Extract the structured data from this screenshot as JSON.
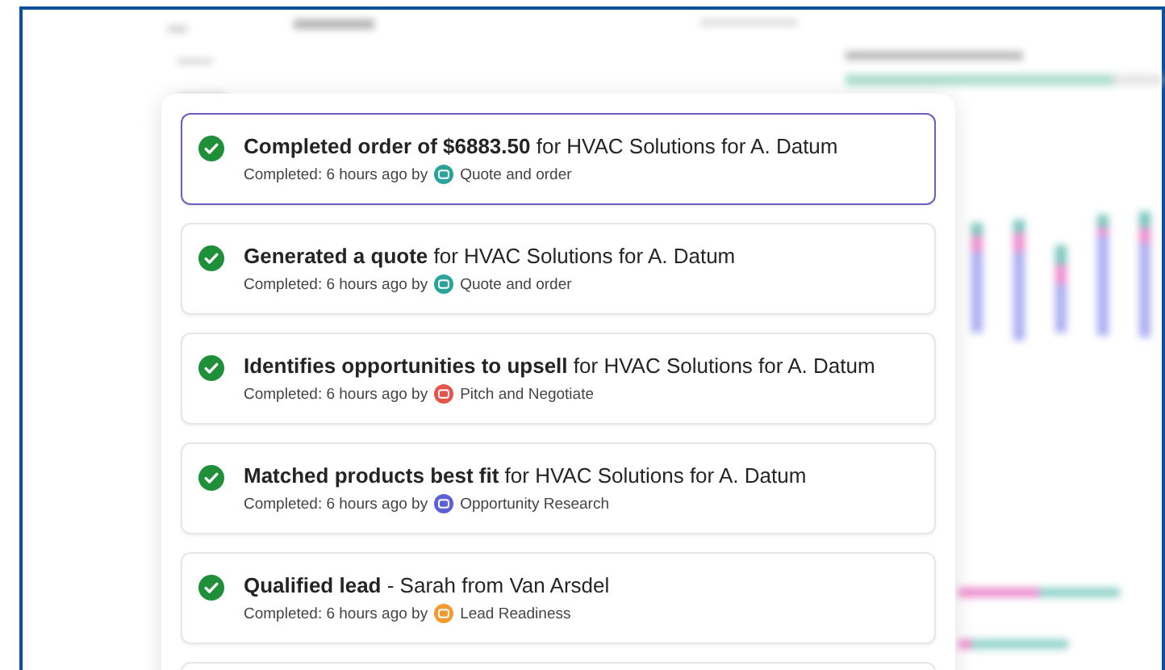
{
  "activity_feed": [
    {
      "title": "**Completed order of $6883.50** for HVAC Solutions for A. Datum",
      "meta": "Completed: 6 hours ago by",
      "agent": "Quote and order",
      "color": "#2aa39c",
      "selected": true
    },
    {
      "title": "**Generated a quote** for HVAC Solutions for A. Datum",
      "meta": "Completed: 6 hours ago by",
      "agent": "Quote and order",
      "color": "#2aa39c",
      "selected": false
    },
    {
      "title": "**Identifies opportunities to upsell** for HVAC Solutions for A. Datum",
      "meta": "Completed: 6 hours ago by",
      "agent": "Pitch and Negotiate",
      "color": "#e5534b",
      "selected": false
    },
    {
      "title": "**Matched products best fit** for HVAC Solutions for A. Datum",
      "meta": "Completed: 6 hours ago by",
      "agent": "Opportunity Research",
      "color": "#5b5fd8",
      "selected": false
    },
    {
      "title": "**Qualified lead** - Sarah from Van Arsdel",
      "meta": "Completed: 6 hours ago by",
      "agent": "Lead Readiness",
      "color": "#f29a2e",
      "selected": false
    }
  ]
}
